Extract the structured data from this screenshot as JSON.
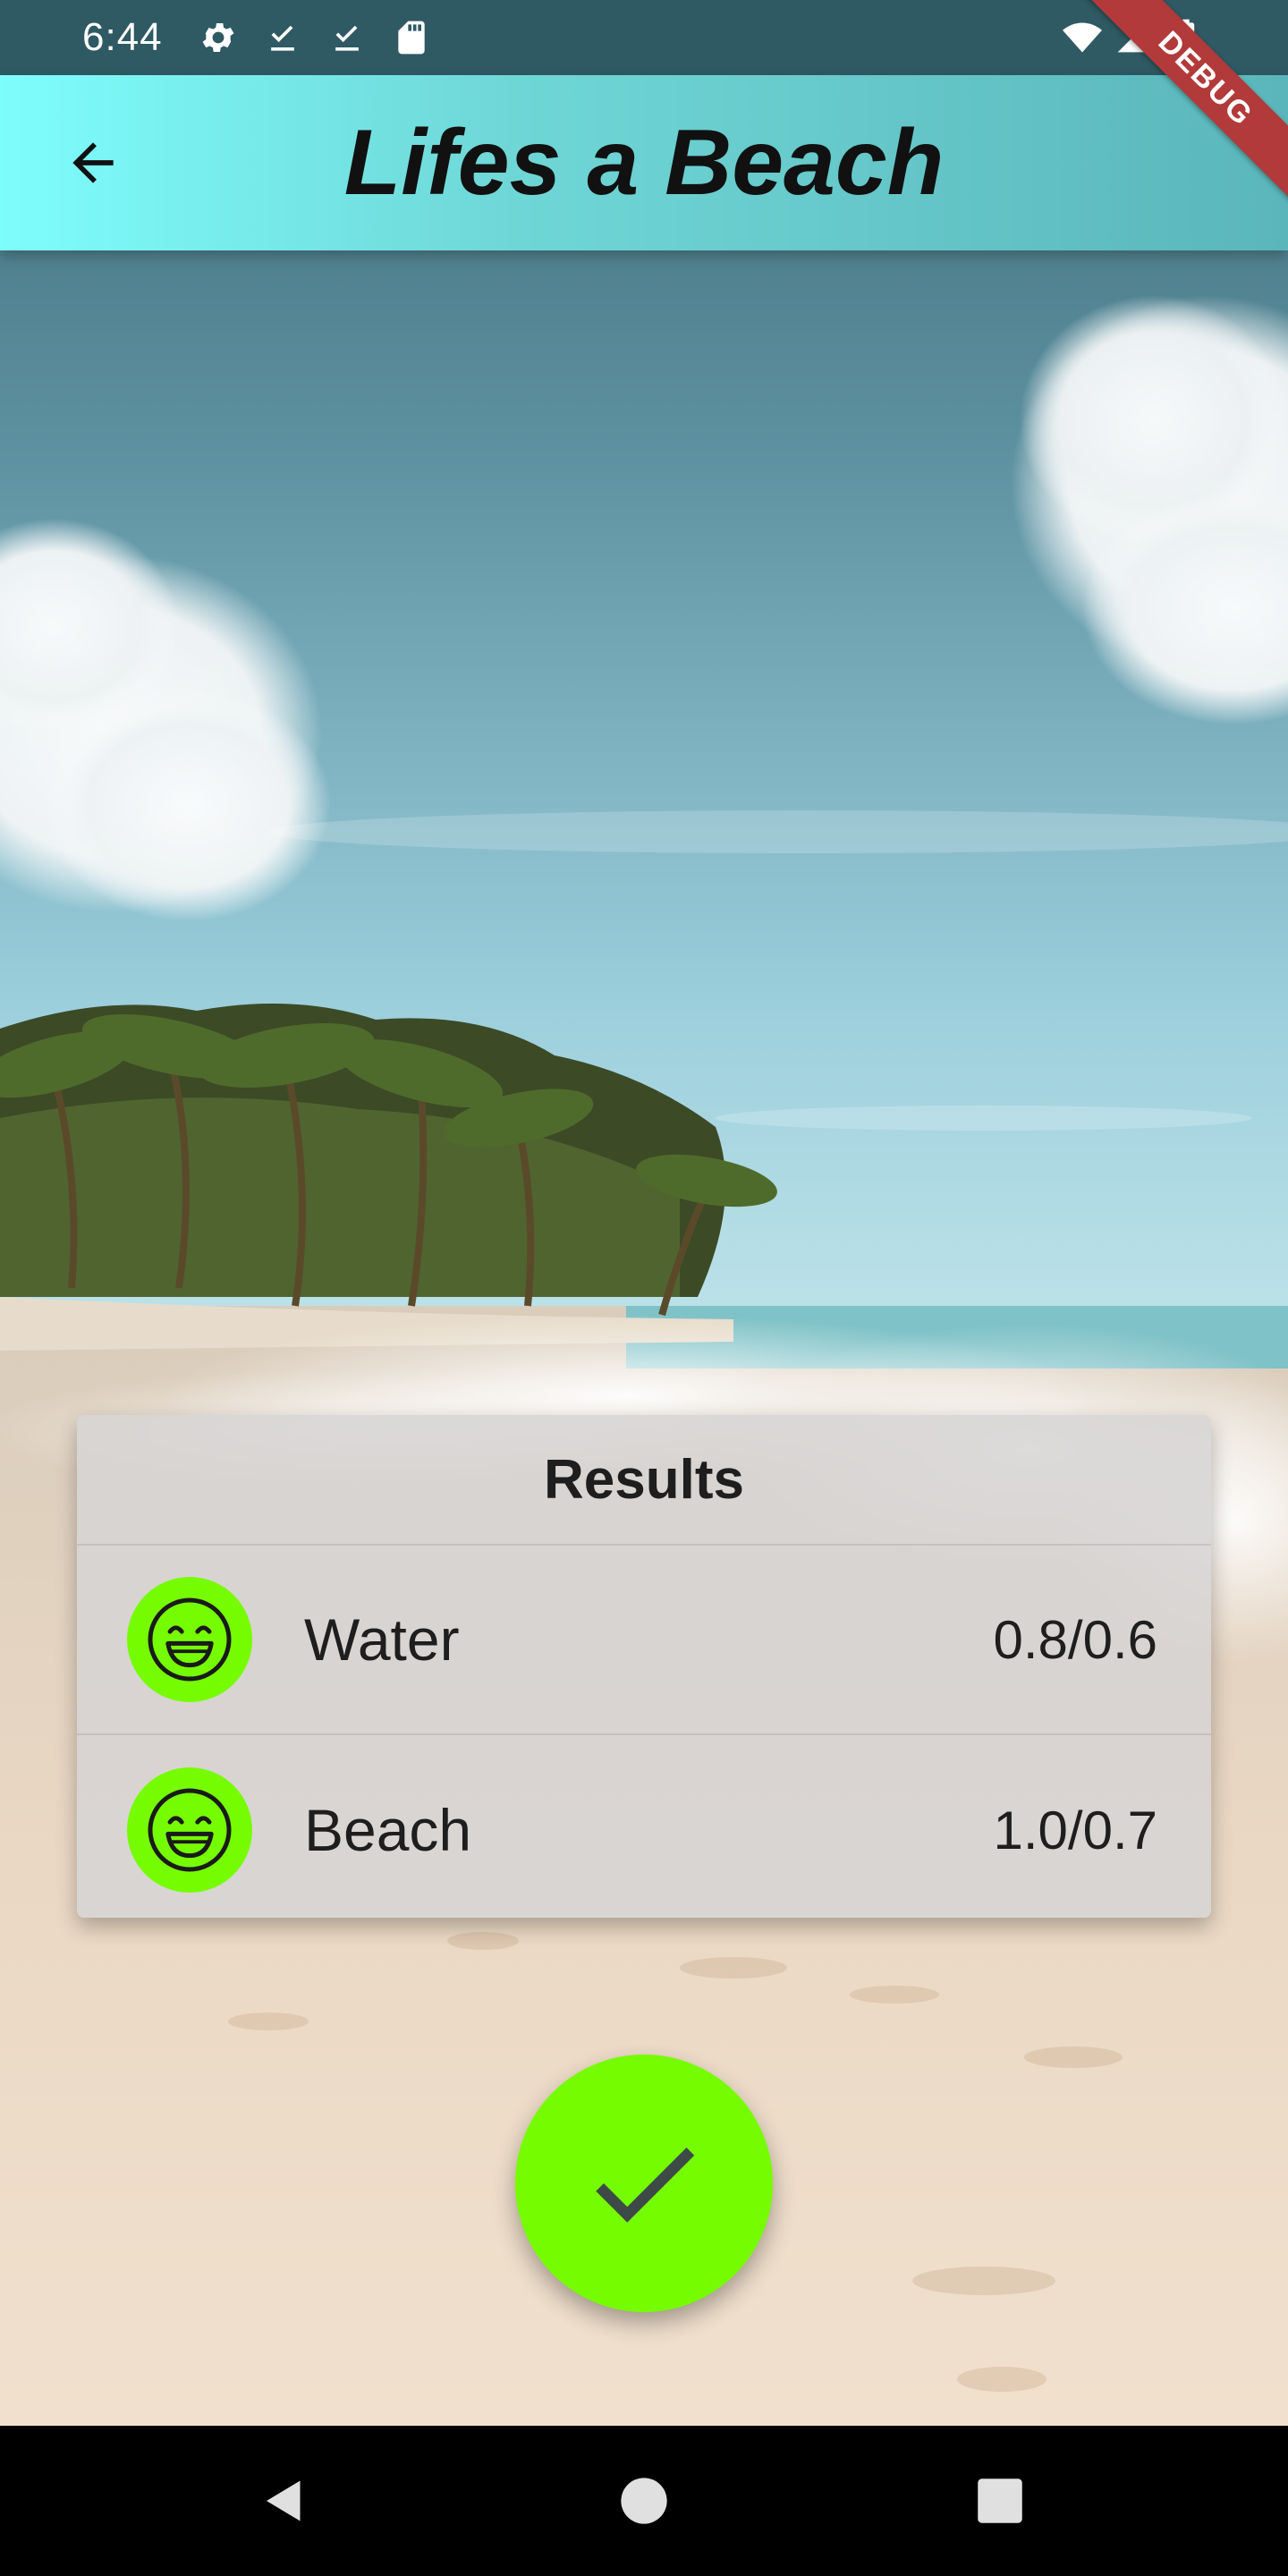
{
  "status_bar": {
    "time": "6:44",
    "left_icons": [
      "gear-icon",
      "download-done-icon",
      "download-done-icon",
      "sd-card-icon"
    ],
    "right_icons": [
      "wifi-icon",
      "cellular-signal-icon",
      "battery-icon"
    ]
  },
  "app_bar": {
    "title": "Lifes a Beach",
    "back_icon": "arrow-back-icon",
    "debug_banner": "DEBUG"
  },
  "results": {
    "title": "Results",
    "items": [
      {
        "label": "Water",
        "score": "0.8/0.6",
        "icon": "grinning-face-icon"
      },
      {
        "label": "Beach",
        "score": "1.0/0.7",
        "icon": "grinning-face-icon"
      }
    ]
  },
  "fab": {
    "icon": "check-icon"
  },
  "nav_bar": {
    "buttons": [
      "back-triangle-icon",
      "home-circle-icon",
      "recents-square-icon"
    ]
  },
  "colors": {
    "accent_green": "#76fc00",
    "app_bar_start": "#7efdfd",
    "app_bar_end": "#5ab6ba",
    "debug_ribbon": "#b23a3a"
  }
}
